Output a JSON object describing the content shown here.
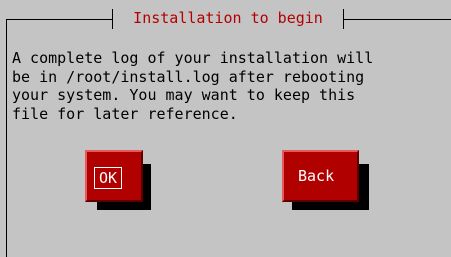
{
  "dialog": {
    "title": "Installation to begin",
    "message": "A complete log of your installation will\nbe in /root/install.log after rebooting\nyour system. You may want to keep this\nfile for later reference."
  },
  "buttons": {
    "ok_label": "OK",
    "back_label": "Back",
    "focused": "ok"
  },
  "colors": {
    "background": "#c4c4c4",
    "title_text": "#b40000",
    "button_face": "#b00000",
    "button_text": "#ffffff",
    "shadow": "#000000"
  }
}
